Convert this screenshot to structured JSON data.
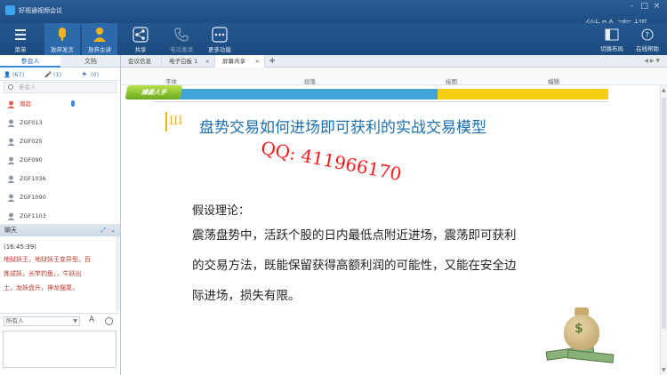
{
  "window": {
    "title": "好视通视频会议",
    "watermark": "微哈直播"
  },
  "toolbar": {
    "menu_label": "菜单",
    "give_up_speaking_label": "放弃发言",
    "give_up_host_label": "放弃主讲",
    "share_label": "共享",
    "phone_invite_label": "电话邀请",
    "more_label": "更多功能",
    "switch_layout_label": "切换布局",
    "online_help_label": "在线帮助"
  },
  "left_panel": {
    "tabs": [
      "参会人",
      "文档"
    ],
    "counts": {
      "attendees": "(67)",
      "speakers": "(1)",
      "hands": "(0)"
    },
    "search_placeholder": "参会人",
    "members": [
      {
        "name": "周超",
        "role": "host"
      },
      {
        "name": "ZGF013",
        "role": "attendee"
      },
      {
        "name": "ZGF025",
        "role": "attendee"
      },
      {
        "name": "ZGF090",
        "role": "attendee"
      },
      {
        "name": "ZGF1036",
        "role": "attendee"
      },
      {
        "name": "ZGF1090",
        "role": "attendee"
      },
      {
        "name": "ZGF1103",
        "role": "attendee"
      }
    ],
    "chat": {
      "header": "聊天",
      "timestamp": "(16:45:39)",
      "lines": [
        "地狱妖王，地狱妖王变异型，百",
        "炼成妖，长竿钓鱼，，牛妖出",
        "土，龙妖盘升，神龙摆尾，"
      ],
      "recipient": "所有人"
    }
  },
  "right_panel": {
    "tabs": [
      {
        "label": "会议信息",
        "closable": false
      },
      {
        "label": "电子白板 1",
        "closable": true
      },
      {
        "label": "屏幕共享",
        "closable": true
      }
    ],
    "ribbon_groups": [
      "字体",
      "段落",
      "绘图",
      "编辑"
    ]
  },
  "slide": {
    "badge": "操盘人手",
    "section_number": "III",
    "title": "盘势交易如何进场即可获利的实战交易模型",
    "qq_overlay": "QQ: 411966170",
    "hypothesis_heading": "假设理论：",
    "body_lines": [
      "震荡盘势中，活跃个股的日内最低点附近进场，震荡即可获利",
      "的交易方法，既能保留获得高额利润的可能性，又能在安全边",
      "际进场，损失有限。"
    ]
  },
  "colors": {
    "chrome_blue": "#1f4f86",
    "accent_blue": "#1a6fb2",
    "band_blue": "#3ea5d6",
    "band_yellow": "#f4cf14",
    "host_red": "#d23a2c",
    "overlay_red": "#ff1a1a",
    "roman_gold": "#f0b50a"
  }
}
